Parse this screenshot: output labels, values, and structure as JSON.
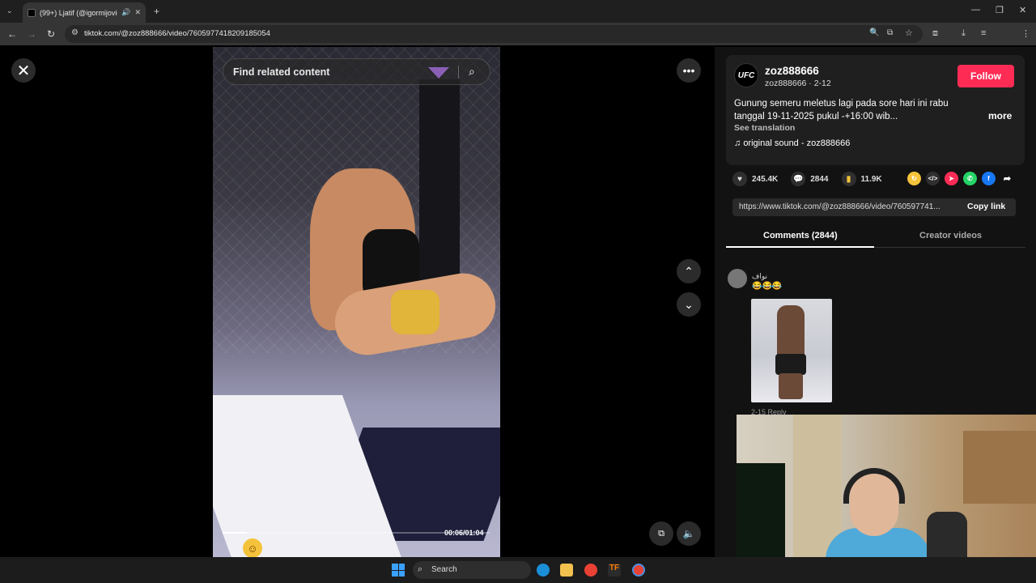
{
  "browser": {
    "tab_title": "(99+) Ljatif (@igormijovic00",
    "url": "tiktok.com/@zoz888666/video/7605977418209185054"
  },
  "video": {
    "search_placeholder": "Find related content",
    "time": "00:06/01:04",
    "progress_fraction": 0.09
  },
  "post": {
    "avatar_text": "UFC",
    "username": "zoz888666",
    "subline": "zoz888666 · 2-12",
    "follow_label": "Follow",
    "description": "Gunung semeru meletus lagi pada sore hari ini rabu tanggal 19-11-2025 pukul -+16:00 wib...",
    "more_label": "more",
    "see_translation": "See translation",
    "sound": "original sound - zoz888666",
    "likes": "245.4K",
    "comments": "2844",
    "saves": "11.9K",
    "link": "https://www.tiktok.com/@zoz888666/video/760597741...",
    "copy_link": "Copy link"
  },
  "tabs": {
    "comments": "Comments (2844)",
    "creator_videos": "Creator videos"
  },
  "comment": {
    "user": "نواف",
    "emojis": "😂😂😂",
    "meta": "2-15   Reply"
  },
  "taskbar": {
    "search_label": "Search"
  },
  "colors": {
    "accent": "#fe2c55",
    "background": "#000000",
    "panel": "#121212"
  }
}
